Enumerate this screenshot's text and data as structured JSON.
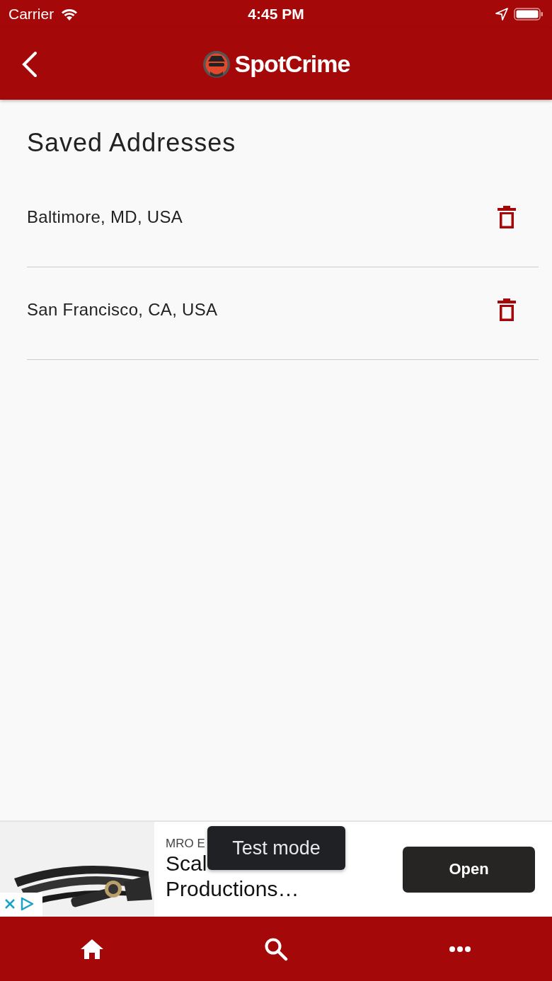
{
  "status_bar": {
    "carrier": "Carrier",
    "time": "4:45 PM"
  },
  "header": {
    "title": "SpotCrime"
  },
  "page_title": "Saved Addresses",
  "addresses": [
    {
      "label": "Baltimore, MD, USA"
    },
    {
      "label": "San Francisco, CA, USA"
    }
  ],
  "ad": {
    "kind": "picture",
    "sponsor": "MRO E",
    "headline_lines": [
      "Scal",
      "Productions…"
    ],
    "button": "Open",
    "toast": "Test mode"
  },
  "tab_bar": [
    {
      "kind": "home"
    },
    {
      "kind": "search"
    },
    {
      "kind": "more"
    }
  ]
}
